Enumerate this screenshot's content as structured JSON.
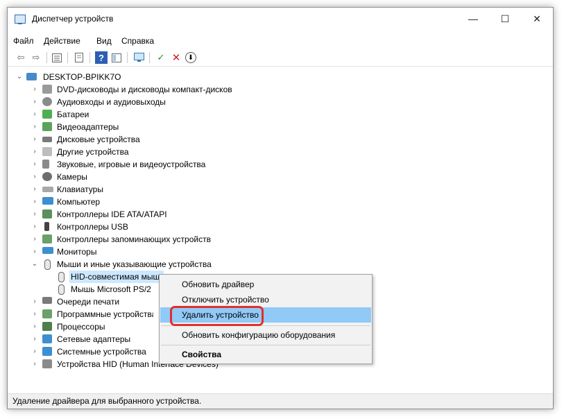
{
  "window": {
    "title": "Диспетчер устройств",
    "minimize": "—",
    "maximize": "☐",
    "close": "✕"
  },
  "menu": [
    "Файл",
    "Действие",
    "Вид",
    "Справка"
  ],
  "toolbar": {
    "back": "⇦",
    "forward": "⇨",
    "help": "?",
    "scan": "✓",
    "remove": "✕",
    "update": "⬇"
  },
  "tree": {
    "root": "DESKTOP-BPIKK7O",
    "categories": [
      "DVD-дисководы и дисководы компакт-дисков",
      "Аудиовходы и аудиовыходы",
      "Батареи",
      "Видеоадаптеры",
      "Дисковые устройства",
      "Другие устройства",
      "Звуковые, игровые и видеоустройства",
      "Камеры",
      "Клавиатуры",
      "Компьютер",
      "Контроллеры IDE ATA/ATAPI",
      "Контроллеры USB",
      "Контроллеры запоминающих устройств",
      "Мониторы",
      "Мыши и иные указывающие устройства",
      "Очереди печати",
      "Программные устройства",
      "Процессоры",
      "Сетевые адаптеры",
      "Системные устройства",
      "Устройства HID (Human Interface Devices)"
    ],
    "mice_children": [
      "HID-совместимая мышь",
      "Мышь Microsoft PS/2"
    ]
  },
  "context_menu": {
    "items": [
      "Обновить драйвер",
      "Отключить устройство",
      "Удалить устройство",
      "Обновить конфигурацию оборудования",
      "Свойства"
    ],
    "highlighted": "Удалить устройство"
  },
  "status": "Удаление драйвера для выбранного устройства.",
  "colors": {
    "highlight": "#91c9f7",
    "selection": "#cce8ff",
    "callout": "#e0302b"
  }
}
